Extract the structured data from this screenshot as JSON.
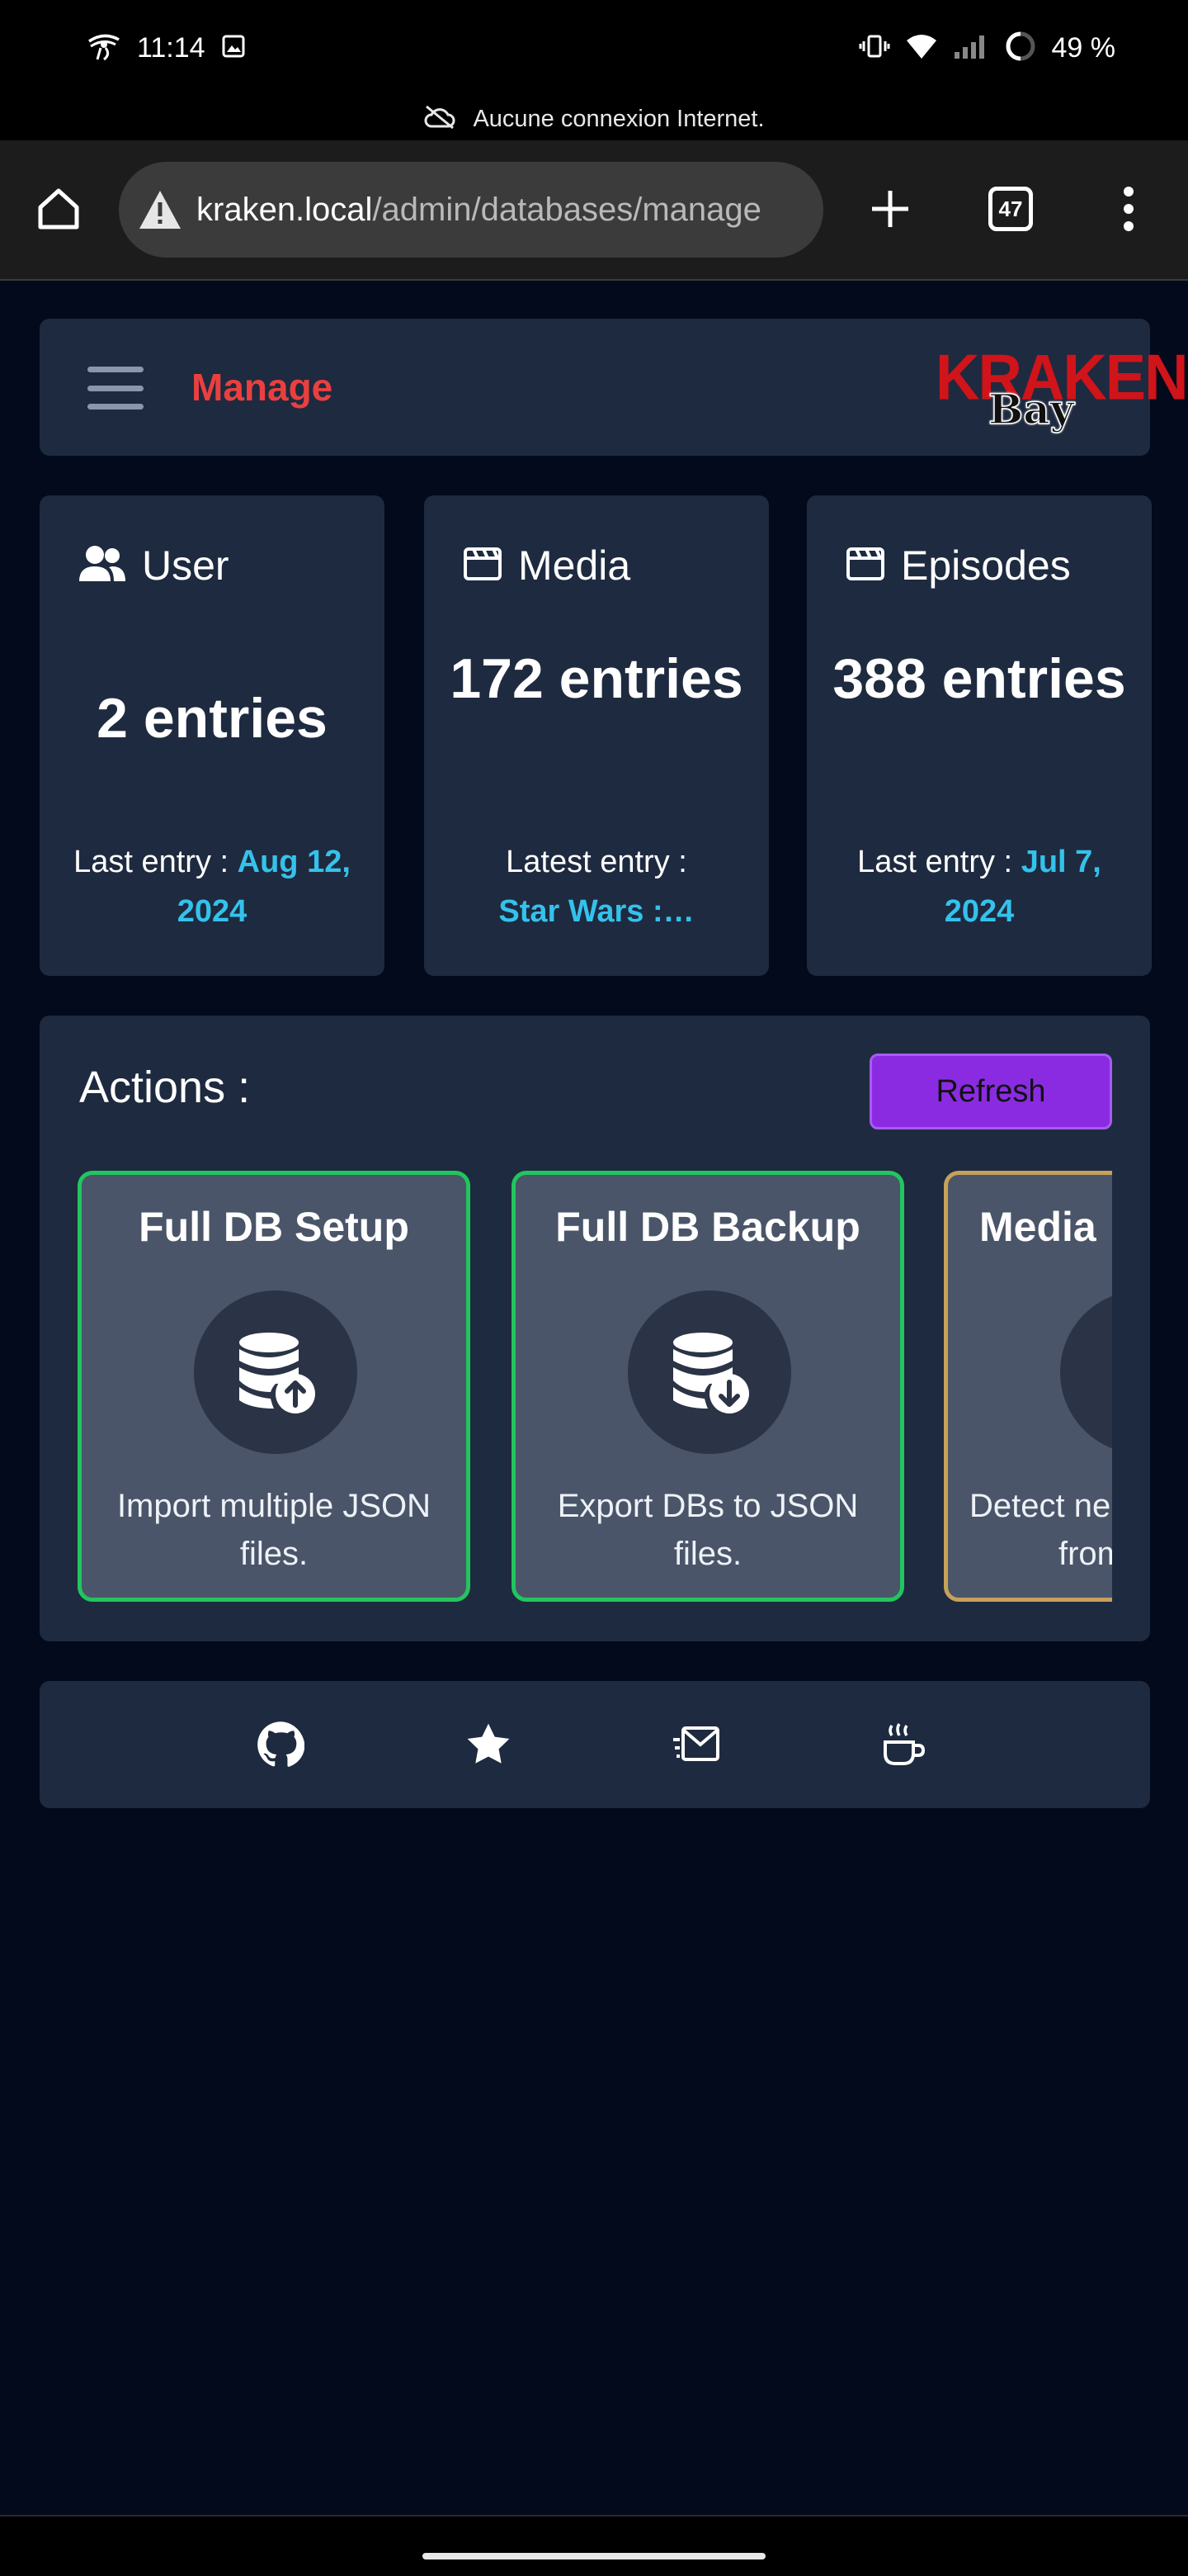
{
  "status_bar": {
    "time": "11:14",
    "battery": "49 %",
    "offline_message": "Aucune connexion Internet."
  },
  "browser": {
    "url_host": "kraken.local",
    "url_path": "/admin/databases/manage",
    "tab_count": "47"
  },
  "header": {
    "title": "Manage",
    "logo_top": "KRAKEN",
    "logo_bottom": "Bay"
  },
  "stats": [
    {
      "label": "User",
      "icon": "users-icon",
      "count": "2 entries",
      "last_prefix": "Last entry :",
      "last_value": "Aug 12, 2024"
    },
    {
      "label": "Media",
      "icon": "clapperboard-icon",
      "count": "172 entries",
      "last_prefix": "Latest entry :",
      "last_value": "Star Wars :…"
    },
    {
      "label": "Episodes",
      "icon": "clapperboard-icon",
      "count": "388 entries",
      "last_prefix": "Last entry :",
      "last_value": "Jul 7, 2024"
    }
  ],
  "actions": {
    "title": "Actions :",
    "refresh_label": "Refresh",
    "cards": [
      {
        "title": "Full DB Setup",
        "icon": "database-upload-icon",
        "description": "Import multiple JSON files."
      },
      {
        "title": "Full DB Backup",
        "icon": "database-download-icon",
        "description": "Export DBs to JSON files."
      },
      {
        "title": "Media",
        "icon": "scan-icon",
        "description_line1": "Detect ne",
        "description_line2": "from"
      }
    ]
  },
  "footer": {
    "icons": [
      "github-icon",
      "star-icon",
      "mail-send-icon",
      "coffee-icon"
    ]
  },
  "colors": {
    "background": "#030a1c",
    "panel": "#1e2a3f",
    "accent_red": "#e9403f",
    "accent_blue": "#34c2ec",
    "refresh_purple": "#8a2be2",
    "card_border_green": "#22c55e",
    "card_border_gold": "#c6a15b"
  }
}
